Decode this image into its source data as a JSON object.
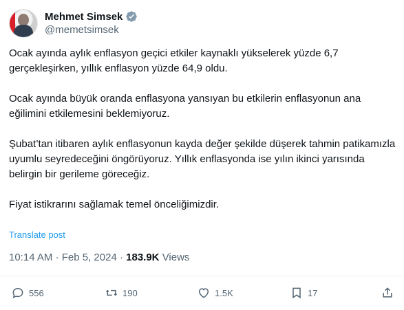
{
  "author": {
    "display_name": "Mehmet Simsek",
    "handle": "@memetsimsek",
    "verified_icon": "verified-badge-icon",
    "badge_color": "#829aab"
  },
  "tweet": {
    "paragraphs": [
      "Ocak ayında aylık enflasyon geçici etkiler kaynaklı yükselerek yüzde 6,7 gerçekleşirken, yıllık enflasyon yüzde 64,9 oldu.",
      "Ocak ayında büyük oranda enflasyona yansıyan bu etkilerin enflasyonun ana eğilimini etkilemesini beklemiyoruz.",
      "Şubat’tan itibaren aylık enflasyonun kayda değer şekilde düşerek tahmin patikamızla uyumlu seyredeceğini öngörüyoruz. Yıllık enflasyonda ise yılın ikinci yarısında belirgin bir gerileme göreceğiz.",
      "Fiyat istikrarını sağlamak temel önceliğimizdir."
    ],
    "translate_label": "Translate post",
    "time": "10:14 AM",
    "date": "Feb 5, 2024",
    "separator": "·",
    "views_count": "183.9K",
    "views_label": "Views"
  },
  "actions": {
    "reply_count": "556",
    "repost_count": "190",
    "like_count": "1.5K",
    "bookmark_count": "17"
  },
  "colors": {
    "link": "#1d9bf0",
    "muted": "#536471",
    "text": "#0f1419"
  }
}
